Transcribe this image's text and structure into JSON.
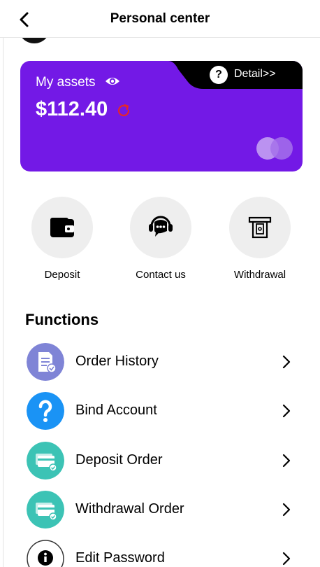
{
  "header": {
    "title": "Personal center",
    "back_icon": "chevron-left-icon"
  },
  "assets": {
    "label": "My assets",
    "value": "$112.40",
    "detail_label": "Detail>>",
    "help_symbol": "?",
    "card_color": "#7319e6",
    "refresh_color": "#e5262b"
  },
  "quick_actions": [
    {
      "label": "Deposit",
      "icon": "wallet-icon"
    },
    {
      "label": "Contact us",
      "icon": "support-chat-icon"
    },
    {
      "label": "Withdrawal",
      "icon": "atm-icon"
    }
  ],
  "functions": {
    "title": "Functions",
    "items": [
      {
        "label": "Order History",
        "icon": "document-icon",
        "color": "#7f84d6"
      },
      {
        "label": "Bind Account",
        "icon": "question-icon",
        "color": "#1a93f5"
      },
      {
        "label": "Deposit Order",
        "icon": "card-icon",
        "color": "#3cc3b5"
      },
      {
        "label": "Withdrawal Order",
        "icon": "card-icon",
        "color": "#3cc3b5"
      },
      {
        "label": "Edit Password",
        "icon": "info-icon",
        "color": "#ffffff"
      }
    ]
  }
}
